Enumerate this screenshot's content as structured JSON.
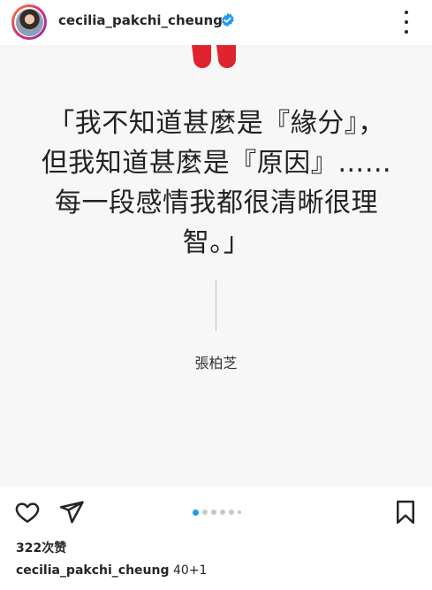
{
  "post_header": {
    "username": "cecilia_pakchi_cheung",
    "verified": true,
    "more_label": "more options"
  },
  "post_image": {
    "quote_text": "「我不知道甚麼是『緣分』，\n但我知道甚麼是『原因』……\n每一段感情我都很清晰很理\n智。」",
    "author": "張柏芝",
    "accent_color": "#e0242f",
    "background": "#f7f7f7"
  },
  "carousel": {
    "total": 6,
    "active_index": 0
  },
  "post_footer": {
    "likes": "322次赞",
    "caption_user": "cecilia_pakchi_cheung",
    "caption_text": " 40+1"
  },
  "icons": {
    "avatar": "avatar",
    "verified": "verified-badge-icon",
    "more": "more-options-icon",
    "like": "heart-icon",
    "share": "share-icon",
    "bookmark": "bookmark-icon"
  },
  "colors": {
    "text": "#262626",
    "verified": "#1d9bf0",
    "carousel_active": "#1d9bf0",
    "carousel_inactive": "#c7c7c7"
  }
}
